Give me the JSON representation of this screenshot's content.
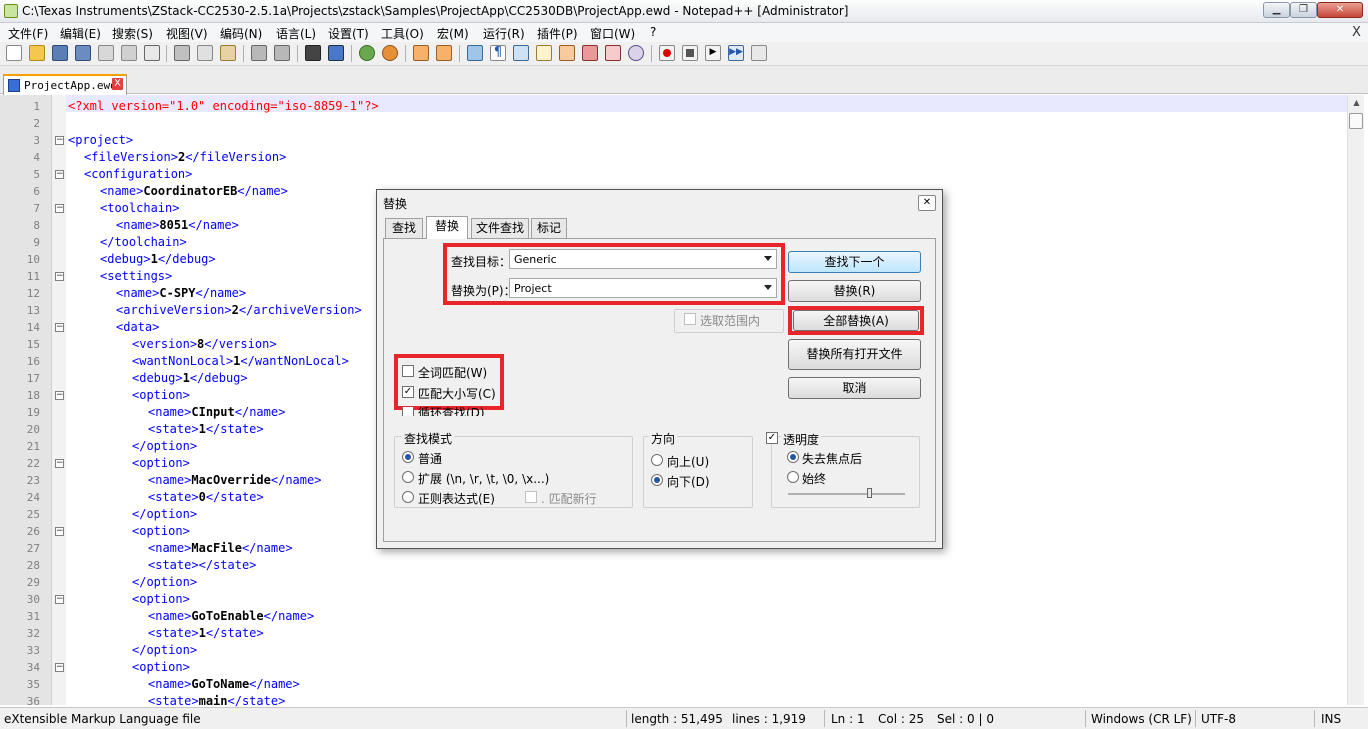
{
  "window": {
    "title": "C:\\Texas Instruments\\ZStack-CC2530-2.5.1a\\Projects\\zstack\\Samples\\ProjectApp\\CC2530DB\\ProjectApp.ewd - Notepad++ [Administrator]"
  },
  "menu": [
    "文件(F)",
    "编辑(E)",
    "搜索(S)",
    "视图(V)",
    "编码(N)",
    "语言(L)",
    "设置(T)",
    "工具(O)",
    "宏(M)",
    "运行(R)",
    "插件(P)",
    "窗口(W)",
    "?"
  ],
  "menu_close": "X",
  "tab": {
    "label": "ProjectApp.ewd",
    "close": "X"
  },
  "editor_lines": [
    {
      "n": "1",
      "indent": 0,
      "fold": "",
      "text": "<?xml version=\"1.0\" encoding=\"iso-8859-1\"?>",
      "pi": true
    },
    {
      "n": "2",
      "indent": 0,
      "fold": "",
      "text": ""
    },
    {
      "n": "3",
      "indent": 0,
      "fold": "-",
      "open": "project",
      "val": "",
      "close": ""
    },
    {
      "n": "4",
      "indent": 1,
      "fold": "",
      "open": "fileVersion",
      "val": "2",
      "close": "fileVersion"
    },
    {
      "n": "5",
      "indent": 1,
      "fold": "-",
      "open": "configuration",
      "val": "",
      "close": ""
    },
    {
      "n": "6",
      "indent": 2,
      "fold": "",
      "open": "name",
      "val": "CoordinatorEB",
      "close": "name"
    },
    {
      "n": "7",
      "indent": 2,
      "fold": "-",
      "open": "toolchain",
      "val": "",
      "close": ""
    },
    {
      "n": "8",
      "indent": 3,
      "fold": "",
      "open": "name",
      "val": "8051",
      "close": "name"
    },
    {
      "n": "9",
      "indent": 2,
      "fold": "",
      "open": "",
      "val": "",
      "close": "toolchain"
    },
    {
      "n": "10",
      "indent": 2,
      "fold": "",
      "open": "debug",
      "val": "1",
      "close": "debug"
    },
    {
      "n": "11",
      "indent": 2,
      "fold": "-",
      "open": "settings",
      "val": "",
      "close": ""
    },
    {
      "n": "12",
      "indent": 3,
      "fold": "",
      "open": "name",
      "val": "C-SPY",
      "close": "name"
    },
    {
      "n": "13",
      "indent": 3,
      "fold": "",
      "open": "archiveVersion",
      "val": "2",
      "close": "archiveVersion"
    },
    {
      "n": "14",
      "indent": 3,
      "fold": "-",
      "open": "data",
      "val": "",
      "close": ""
    },
    {
      "n": "15",
      "indent": 4,
      "fold": "",
      "open": "version",
      "val": "8",
      "close": "version"
    },
    {
      "n": "16",
      "indent": 4,
      "fold": "",
      "open": "wantNonLocal",
      "val": "1",
      "close": "wantNonLocal"
    },
    {
      "n": "17",
      "indent": 4,
      "fold": "",
      "open": "debug",
      "val": "1",
      "close": "debug"
    },
    {
      "n": "18",
      "indent": 4,
      "fold": "-",
      "open": "option",
      "val": "",
      "close": ""
    },
    {
      "n": "19",
      "indent": 5,
      "fold": "",
      "open": "name",
      "val": "CInput",
      "close": "name"
    },
    {
      "n": "20",
      "indent": 5,
      "fold": "",
      "open": "state",
      "val": "1",
      "close": "state"
    },
    {
      "n": "21",
      "indent": 4,
      "fold": "",
      "open": "",
      "val": "",
      "close": "option"
    },
    {
      "n": "22",
      "indent": 4,
      "fold": "-",
      "open": "option",
      "val": "",
      "close": ""
    },
    {
      "n": "23",
      "indent": 5,
      "fold": "",
      "open": "name",
      "val": "MacOverride",
      "close": "name"
    },
    {
      "n": "24",
      "indent": 5,
      "fold": "",
      "open": "state",
      "val": "0",
      "close": "state"
    },
    {
      "n": "25",
      "indent": 4,
      "fold": "",
      "open": "",
      "val": "",
      "close": "option"
    },
    {
      "n": "26",
      "indent": 4,
      "fold": "-",
      "open": "option",
      "val": "",
      "close": ""
    },
    {
      "n": "27",
      "indent": 5,
      "fold": "",
      "open": "name",
      "val": "MacFile",
      "close": "name"
    },
    {
      "n": "28",
      "indent": 5,
      "fold": "",
      "open": "state",
      "val": "",
      "close": "state"
    },
    {
      "n": "29",
      "indent": 4,
      "fold": "",
      "open": "",
      "val": "",
      "close": "option"
    },
    {
      "n": "30",
      "indent": 4,
      "fold": "-",
      "open": "option",
      "val": "",
      "close": ""
    },
    {
      "n": "31",
      "indent": 5,
      "fold": "",
      "open": "name",
      "val": "GoToEnable",
      "close": "name"
    },
    {
      "n": "32",
      "indent": 5,
      "fold": "",
      "open": "state",
      "val": "1",
      "close": "state"
    },
    {
      "n": "33",
      "indent": 4,
      "fold": "",
      "open": "",
      "val": "",
      "close": "option"
    },
    {
      "n": "34",
      "indent": 4,
      "fold": "-",
      "open": "option",
      "val": "",
      "close": ""
    },
    {
      "n": "35",
      "indent": 5,
      "fold": "",
      "open": "name",
      "val": "GoToName",
      "close": "name"
    },
    {
      "n": "36",
      "indent": 5,
      "fold": "",
      "open": "state",
      "val": "main",
      "close": "state"
    }
  ],
  "dialog": {
    "title": "替换",
    "close": "✕",
    "tabs": [
      "查找",
      "替换",
      "文件查找",
      "标记"
    ],
    "find_label": "查找目标：",
    "find_value": "Generic",
    "replace_label": "替换为(P)：",
    "replace_value": "Project",
    "in_selection": "选取范围内",
    "whole_word": "全词匹配(W)",
    "match_case": "匹配大小写(C)",
    "wrap": "循环查找(D)",
    "search_mode_title": "查找模式",
    "mode_normal": "普通",
    "mode_extended": "扩展 (\\n, \\r, \\t, \\0, \\x...)",
    "mode_regex": "正则表达式(E)",
    "dot_newline": ". 匹配新行",
    "direction_title": "方向",
    "dir_up": "向上(U)",
    "dir_down": "向下(D)",
    "transparency": "透明度",
    "on_lose_focus": "失去焦点后",
    "always": "始终",
    "btn_find_next": "查找下一个",
    "btn_replace": "替换(R)",
    "btn_replace_all": "全部替换(A)",
    "btn_replace_all_open": "替换所有打开文件",
    "btn_cancel": "取消",
    "state": {
      "whole_word": false,
      "match_case": true,
      "wrap": false,
      "mode": "normal",
      "direction": "down",
      "transparency": true,
      "transparency_when": "on_lose_focus",
      "transparency_level": 0.7
    }
  },
  "status": {
    "filetype": "eXtensible Markup Language file",
    "length": "length : 51,495",
    "lines": "lines : 1,919",
    "ln": "Ln : 1",
    "col": "Col : 25",
    "sel": "Sel : 0 | 0",
    "eol": "Windows (CR LF)",
    "enc": "UTF-8",
    "ins": "INS"
  },
  "colors": {
    "highlight_red": "#e8252b",
    "tab_accent": "#f7a000",
    "tag": "#0000ff",
    "caret_line": "#e8e8ff"
  }
}
